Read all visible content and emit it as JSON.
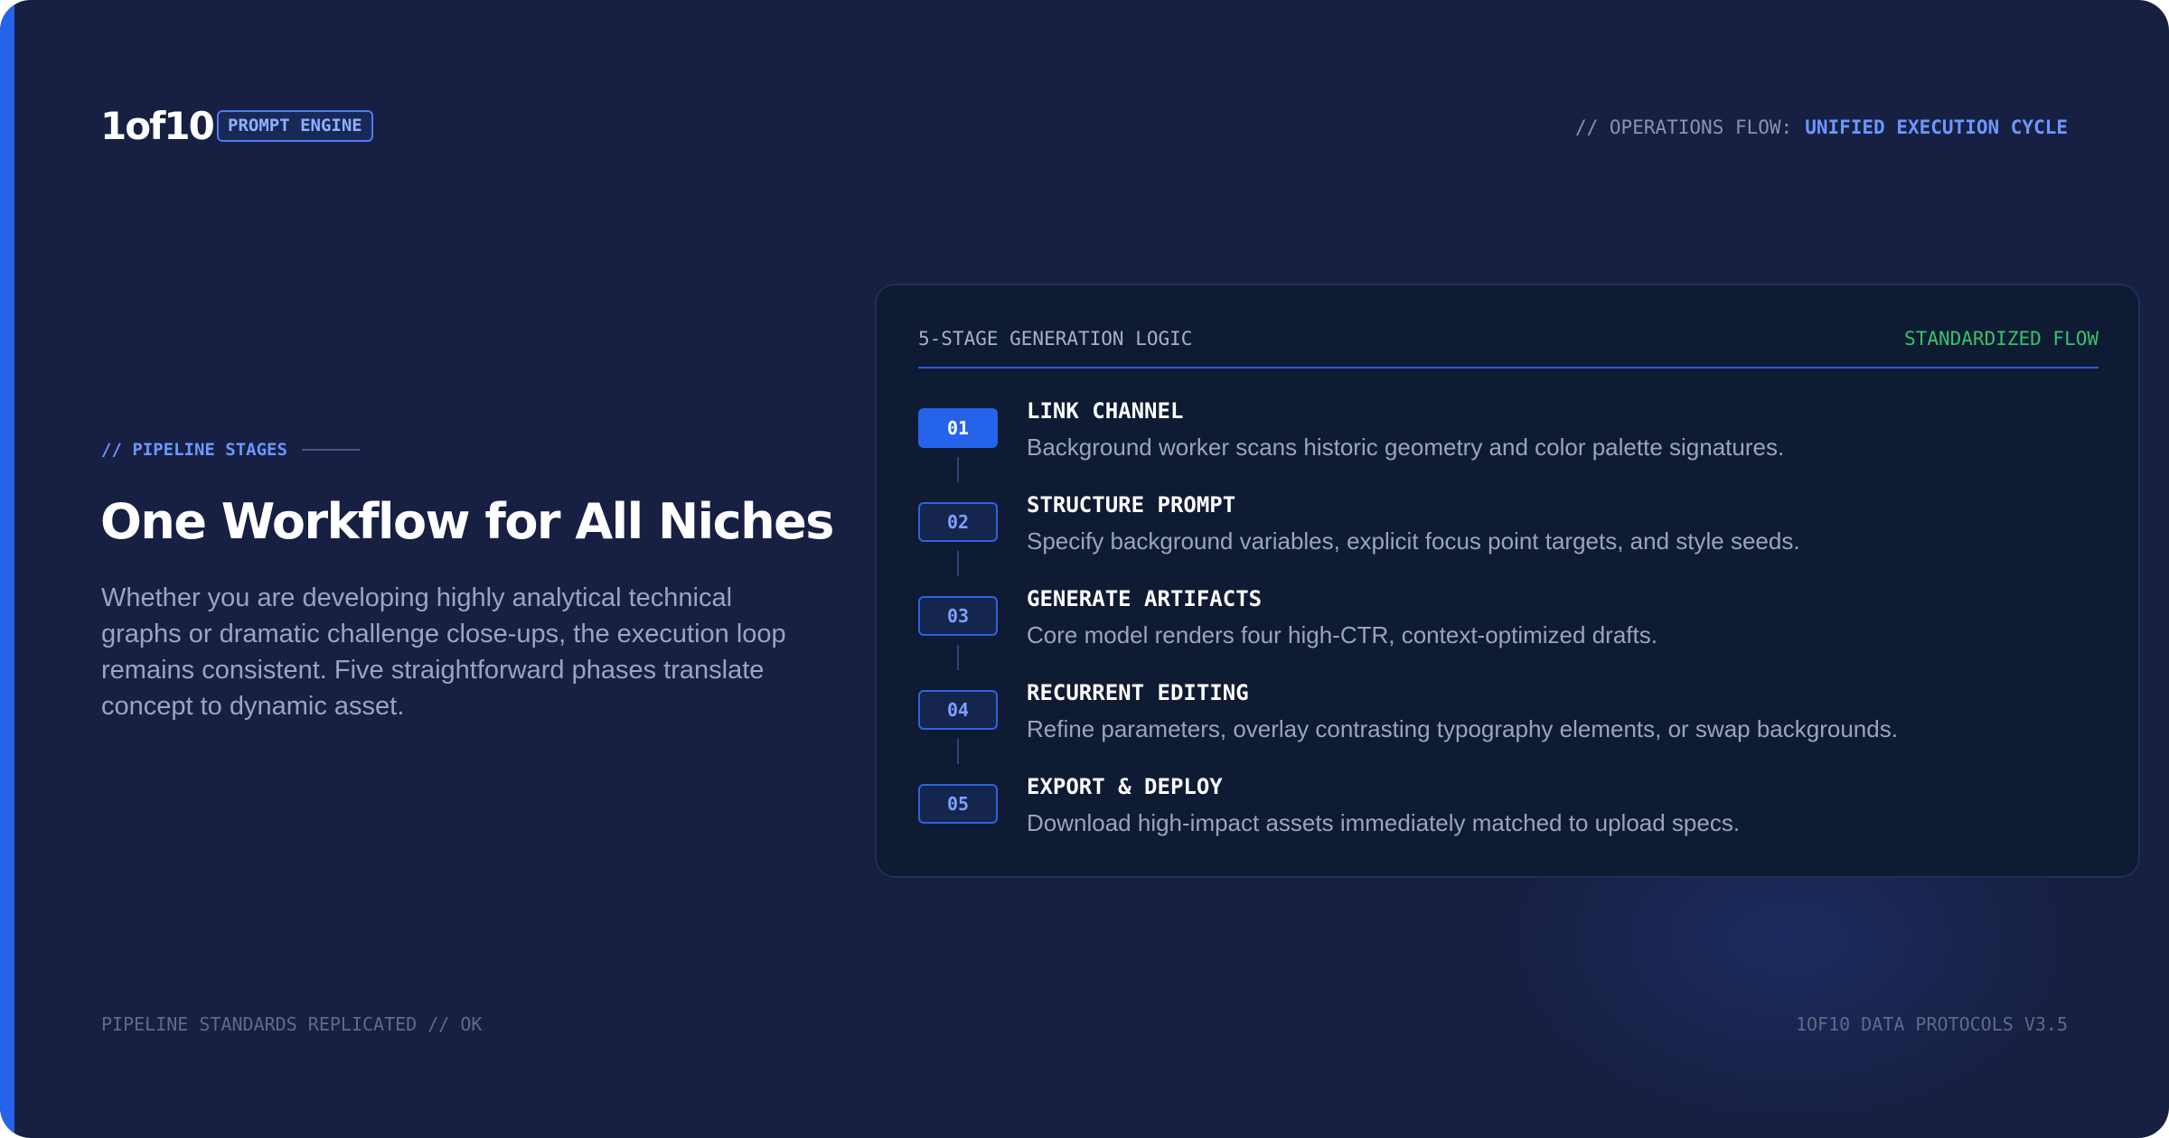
{
  "header": {
    "logo": "1of10",
    "badge": "PROMPT ENGINE",
    "ops_label": "// OPERATIONS FLOW:",
    "ops_value": "UNIFIED EXECUTION CYCLE"
  },
  "intro": {
    "eyebrow": "// PIPELINE STAGES",
    "headline": "One Workflow for All Niches",
    "lead": "Whether you are developing highly analytical technical graphs or dramatic challenge close-ups, the execution loop remains consistent. Five straightforward phases translate concept to dynamic asset."
  },
  "card": {
    "title": "5-STAGE GENERATION LOGIC",
    "status": "STANDARDIZED FLOW",
    "steps": [
      {
        "num": "01",
        "title": "LINK CHANNEL",
        "desc": "Background worker scans historic geometry and color palette signatures."
      },
      {
        "num": "02",
        "title": "STRUCTURE PROMPT",
        "desc": "Specify background variables, explicit focus point targets, and style seeds."
      },
      {
        "num": "03",
        "title": "GENERATE ARTIFACTS",
        "desc": "Core model renders four high-CTR, context-optimized drafts."
      },
      {
        "num": "04",
        "title": "RECURRENT EDITING",
        "desc": "Refine parameters, overlay contrasting typography elements, or swap backgrounds."
      },
      {
        "num": "05",
        "title": "EXPORT & DEPLOY",
        "desc": "Download high-impact assets immediately matched to upload specs."
      }
    ]
  },
  "footer": {
    "left": "PIPELINE STANDARDS REPLICATED // OK",
    "right": "1OF10 DATA PROTOCOLS V3.5"
  },
  "colors": {
    "background": "#172042",
    "card": "#0f1a33",
    "accent": "#2563eb",
    "status_green": "#33c46b"
  }
}
